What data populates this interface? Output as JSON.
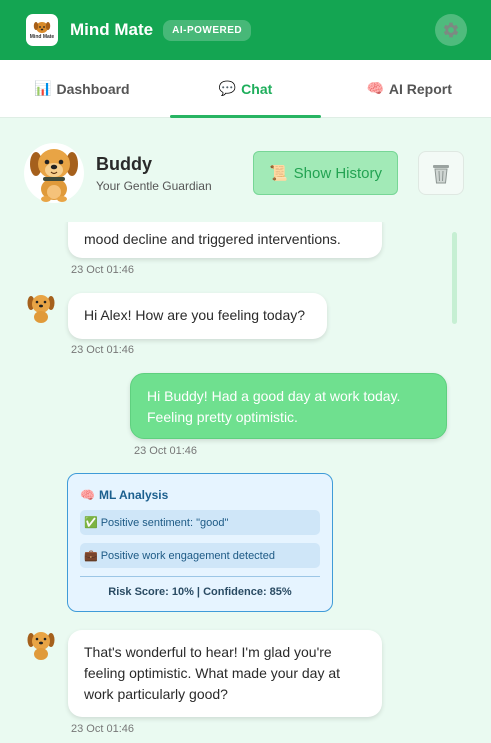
{
  "app": {
    "name": "Mind Mate",
    "badge": "AI-POWERED",
    "logo_text": "Mind Mate"
  },
  "tabs": [
    {
      "emoji": "📊",
      "label": "Dashboard",
      "active": false
    },
    {
      "emoji": "💬",
      "label": "Chat",
      "active": true
    },
    {
      "emoji": "🧠",
      "label": "AI Report",
      "active": false
    }
  ],
  "chat_header": {
    "bot_name": "Buddy",
    "bot_subtitle": "Your Gentle Guardian",
    "history_button": {
      "emoji": "📜",
      "label": "Show History"
    },
    "trash_icon": "trash-icon"
  },
  "messages": [
    {
      "from": "bot",
      "text": "mood decline and triggered interventions.",
      "time": "23 Oct 01:46"
    },
    {
      "from": "bot",
      "text": "Hi Alex! How are you feeling today?",
      "time": "23 Oct 01:46"
    },
    {
      "from": "user",
      "text": "Hi Buddy! Had a good day at work today. Feeling pretty optimistic.",
      "time": "23 Oct 01:46"
    },
    {
      "from": "bot",
      "text": "That's wonderful to hear! I'm glad you're feeling optimistic. What made your day at work particularly good?",
      "time": "23 Oct 01:46"
    }
  ],
  "ml_analysis": {
    "emoji": "🧠",
    "title": "ML Analysis",
    "items": [
      {
        "emoji": "✅",
        "text": "Positive sentiment: \"good\""
      },
      {
        "emoji": "💼",
        "text": "Positive work engagement detected"
      }
    ],
    "footer": "Risk Score: 10% | Confidence: 85%"
  },
  "colors": {
    "primary": "#14a552",
    "accent": "#27b462",
    "user_bubble": "#6fe08f",
    "ml_border": "#3f9bd8"
  }
}
